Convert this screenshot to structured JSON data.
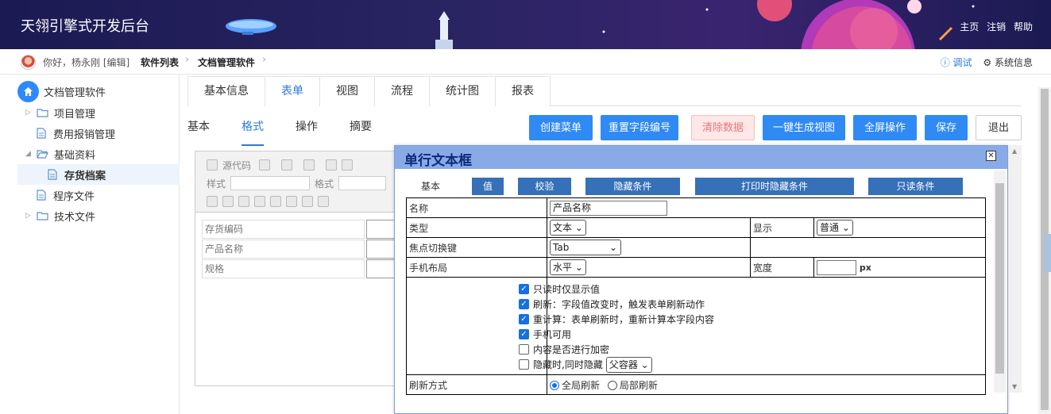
{
  "header": {
    "title": "天翎引擎式开发后台",
    "links": [
      "主页",
      "注销",
      "帮助"
    ]
  },
  "breadcrumb": {
    "greeting": "你好，杨永刚 [编辑]",
    "items": [
      "软件列表",
      "文档管理软件"
    ],
    "debug": "调试",
    "sysinfo": "系统信息"
  },
  "sidebar": {
    "root": "文档管理软件",
    "items": [
      {
        "label": "项目管理",
        "type": "folder"
      },
      {
        "label": "费用报销管理",
        "type": "file"
      },
      {
        "label": "基础资料",
        "type": "folder-open"
      },
      {
        "label": "存货档案",
        "type": "file",
        "selected": true
      },
      {
        "label": "程序文件",
        "type": "file"
      },
      {
        "label": "技术文件",
        "type": "folder"
      }
    ]
  },
  "tabs": [
    "基本信息",
    "表单",
    "视图",
    "流程",
    "统计图",
    "报表"
  ],
  "subtabs": [
    "基本",
    "格式",
    "操作",
    "摘要"
  ],
  "toolbar": [
    "创建菜单",
    "重置字段编号",
    "清除数据",
    "一键生成视图",
    "全屏操作",
    "保存",
    "退出"
  ],
  "editor": {
    "toolbar_row1": "源代码",
    "style_label": "样式",
    "format_label": "格式",
    "fields": [
      "存货编码",
      "产品名称",
      "规格"
    ]
  },
  "dialog": {
    "title": "单行文本框",
    "tabs": [
      "基本",
      "值",
      "校验",
      "隐藏条件",
      "打印时隐藏条件",
      "只读条件"
    ],
    "name_label": "名称",
    "name_value": "产品名称",
    "type_label": "类型",
    "type_value": "文本",
    "display_label": "显示",
    "display_value": "普通",
    "focus_label": "焦点切换键",
    "focus_value": "Tab",
    "mobile_label": "手机布局",
    "mobile_value": "水平",
    "width_label": "宽度",
    "width_unit": "px",
    "width_value": "",
    "options": [
      {
        "label": "只读时仅显示值",
        "checked": true
      },
      {
        "label": "刷新：字段值改变时，触发表单刷新动作",
        "checked": true
      },
      {
        "label": "重计算：表单刷新时，重新计算本字段内容",
        "checked": true
      },
      {
        "label": "手机可用",
        "checked": true
      },
      {
        "label": "内容是否进行加密",
        "checked": false
      },
      {
        "label": "隐藏时,同时隐藏",
        "checked": false
      }
    ],
    "hide_select": "父容器",
    "refresh_label": "刷新方式",
    "refresh_all": "全局刷新",
    "refresh_part": "局部刷新"
  },
  "colors": {
    "accent": "#2f8af3",
    "dialog_header": "#88abe8",
    "dialog_tab": "#3570b8"
  }
}
